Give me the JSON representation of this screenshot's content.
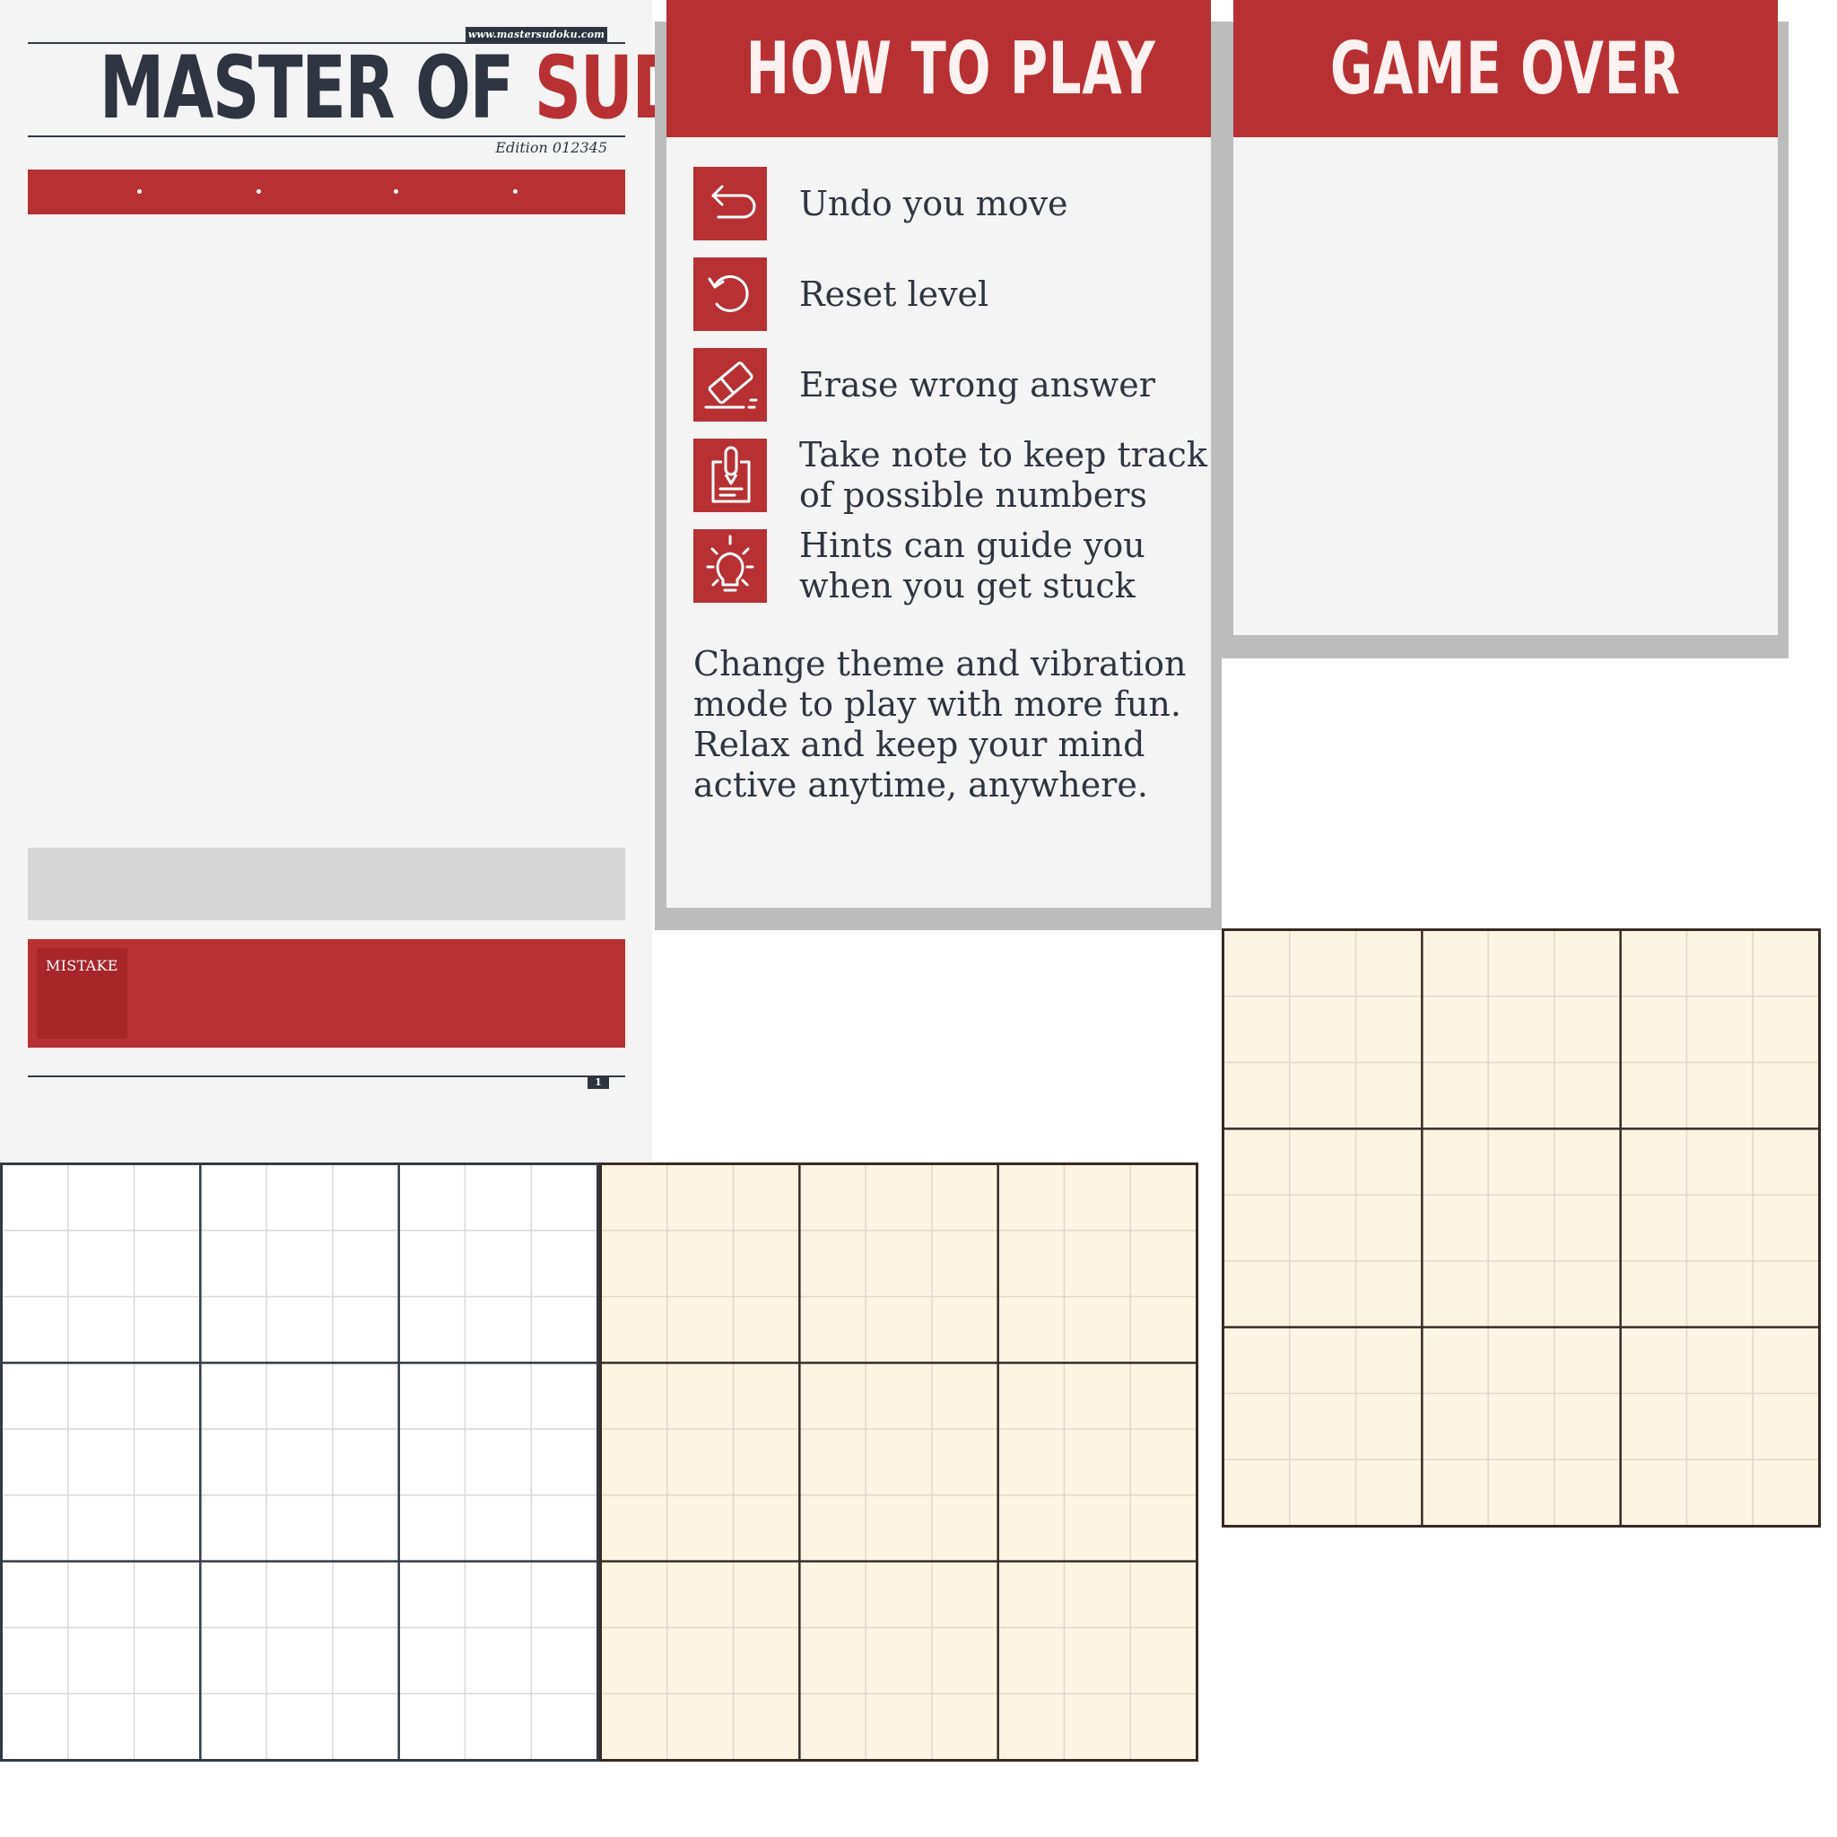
{
  "game_screen": {
    "website": "www.mastersudoku.com",
    "logo_part1": "MASTER OF ",
    "logo_part2": "SUDOKU",
    "edition": "Edition 012345",
    "mistake_label": "MISTAKE",
    "page_number": "1"
  },
  "how_to_play": {
    "title": "HOW TO PLAY",
    "items": [
      {
        "icon": "undo-icon",
        "label": "Undo you move"
      },
      {
        "icon": "reset-icon",
        "label": "Reset level"
      },
      {
        "icon": "eraser-icon",
        "label": "Erase wrong answer"
      },
      {
        "icon": "note-icon",
        "label": "Take note to keep track of possible numbers"
      },
      {
        "icon": "hint-icon",
        "label": "Hints can guide you when you get stuck"
      }
    ],
    "description": "Change theme and vibration mode to play with more fun. Relax and keep your mind active anytime, anywhere."
  },
  "game_over": {
    "title": "GAME OVER"
  },
  "boards": [
    {
      "name": "white-theme",
      "background": "#ffffff",
      "thin_line": "#d8d8d8",
      "thick_line": "#333a44"
    },
    {
      "name": "cream-theme",
      "background": "#fcf5e4",
      "thin_line": "#e3d9c2",
      "thick_line": "#3a2a24"
    },
    {
      "name": "cream-theme-2",
      "background": "#fcf5e4",
      "thin_line": "#e3d9c2",
      "thick_line": "#3a2a24"
    }
  ],
  "colors": {
    "accent_red": "#b83132",
    "dark_text": "#2f3540",
    "panel_bg": "#f4f4f4",
    "shadow": "#bcbcbc"
  }
}
